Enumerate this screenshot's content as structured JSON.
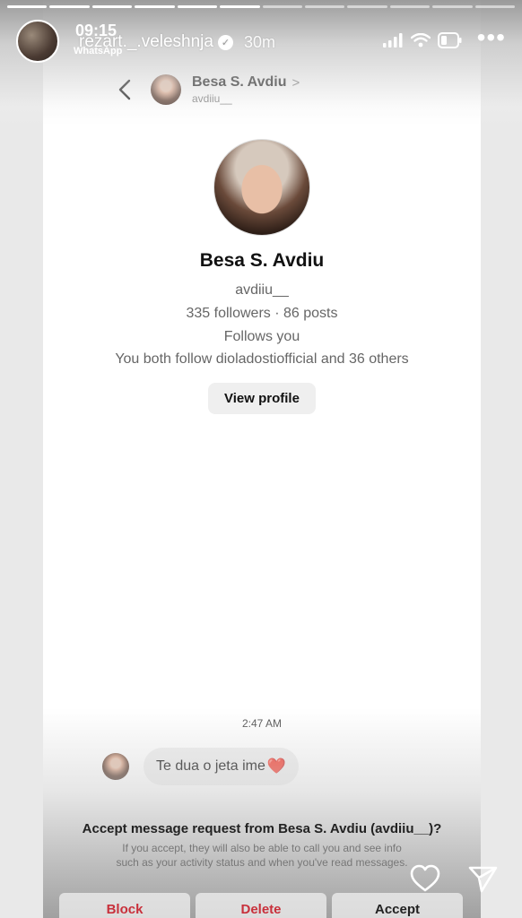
{
  "story": {
    "clock": "09:15",
    "source_app": "WhatsApp",
    "username": "rezart._.veleshnja",
    "verified_icon": "verified-badge-icon",
    "posted_ago": "30m"
  },
  "chat": {
    "header_name": "Besa S. Avdiu",
    "header_chevron": ">",
    "header_username": "avdiiu__",
    "profile": {
      "name": "Besa S. Avdiu",
      "username": "avdiiu__",
      "stats": "335 followers · 86 posts",
      "follows_you": "Follows you",
      "mutual": "You both follow dioladostiofficial and 36 others",
      "view_profile_label": "View profile"
    },
    "message_time": "2:47 AM",
    "message_text": "Te dua o jeta ime",
    "message_emoji": "❤️",
    "request_title": "Accept message request from Besa S. Avdiu (avdiiu__)?",
    "request_desc": "If you accept, they will also be able to call you and see info such as your activity status and when you've read messages.",
    "actions": {
      "block": "Block",
      "delete": "Delete",
      "accept": "Accept"
    }
  },
  "colors": {
    "danger": "#c8303b",
    "bubble": "#efefef",
    "accent_heart": "#e0243a"
  }
}
